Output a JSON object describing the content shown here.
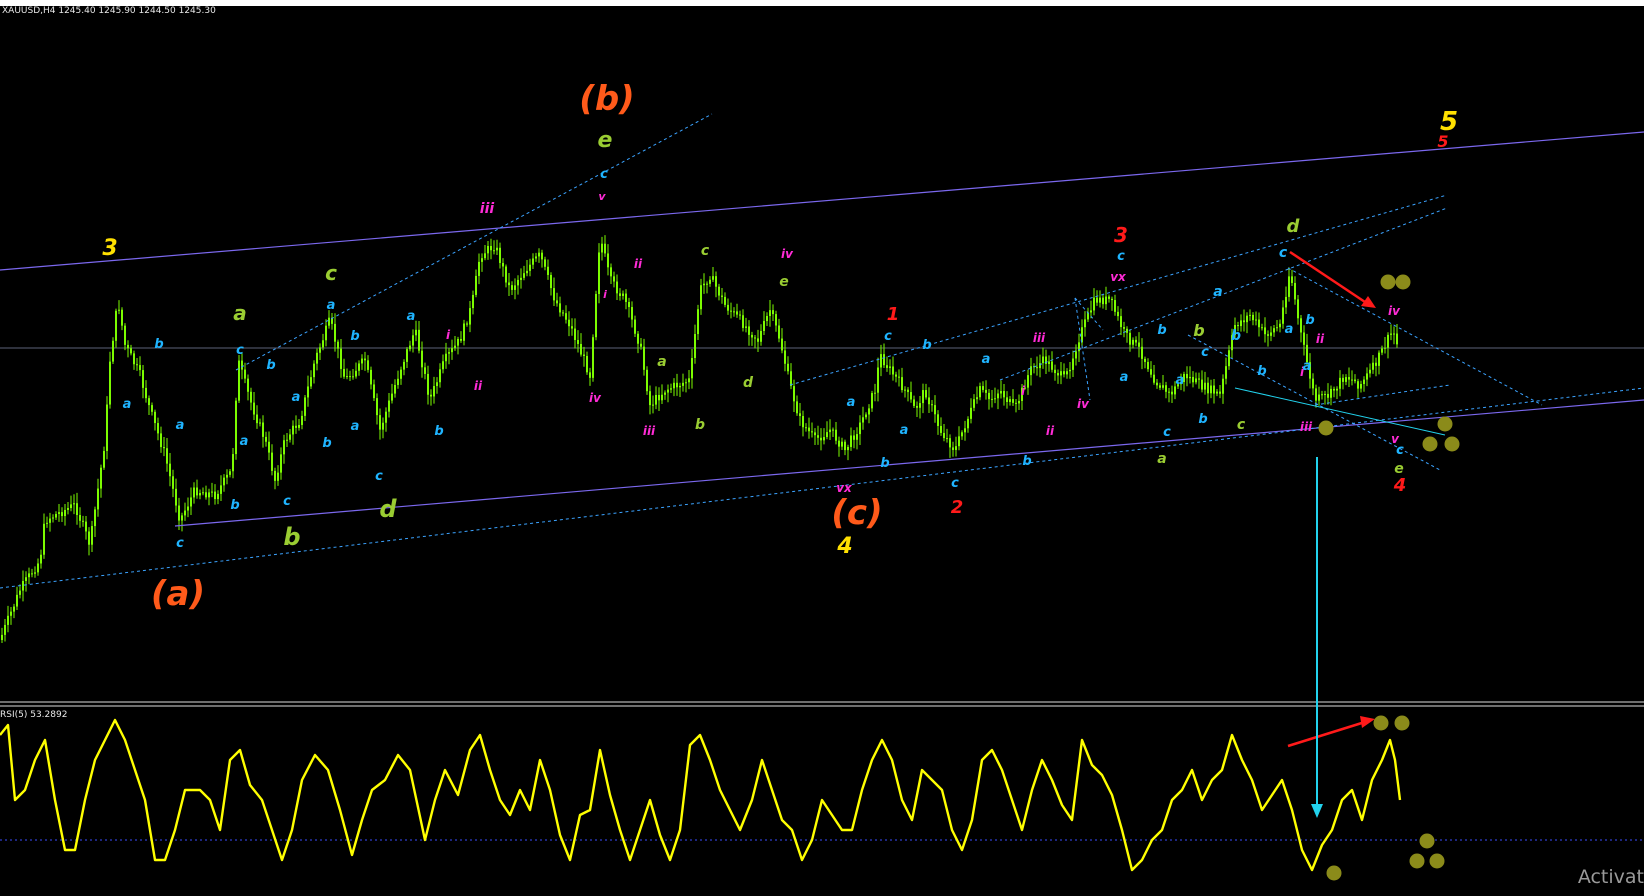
{
  "header": {
    "symbol_line": "XAUUSD,H4  1245.40 1245.90 1244.50 1245.30"
  },
  "indicator": {
    "label": "RSI(5) 53.2892"
  },
  "watermark": "Activat",
  "colors": {
    "background": "#000000",
    "candles": "#7CFC00",
    "channel": "#7B68EE",
    "dotted_trend": "#3BA3FF",
    "rsi": "#FFFF00",
    "arrow_red": "#FF1A1A",
    "arrow_cyan": "#22D3EE",
    "marker_dot": "#8B8B1A"
  },
  "chart_data": {
    "type": "candlestick",
    "symbol": "XAUUSD",
    "timeframe": "H4",
    "last_quote": {
      "open": 1245.4,
      "high": 1245.9,
      "low": 1244.5,
      "close": 1245.3
    },
    "indicator": {
      "name": "RSI",
      "period": 5,
      "value": 53.2892
    },
    "wave_labels": [
      {
        "text": "3",
        "color": "#FFE000"
      },
      {
        "text": "(b)",
        "color": "#FF5A1A"
      },
      {
        "text": "e",
        "color": "#9ACD32"
      },
      {
        "text": "(a)",
        "color": "#FF5A1A"
      },
      {
        "text": "(c)",
        "color": "#FF5A1A"
      },
      {
        "text": "4",
        "color": "#FFE000"
      },
      {
        "text": "5",
        "color": "#FFE000"
      },
      {
        "text": "5",
        "color": "#FF1A1A"
      },
      {
        "text": "3",
        "color": "#FF1A1A"
      },
      {
        "text": "1",
        "color": "#FF1A1A"
      },
      {
        "text": "2",
        "color": "#FF1A1A"
      },
      {
        "text": "4",
        "color": "#FF1A1A"
      },
      {
        "text": "a",
        "color": "#9ACD32"
      },
      {
        "text": "b",
        "color": "#9ACD32"
      },
      {
        "text": "c",
        "color": "#9ACD32"
      },
      {
        "text": "d",
        "color": "#9ACD32"
      },
      {
        "text": "c",
        "color": "#9ACD32"
      },
      {
        "text": "e",
        "color": "#9ACD32"
      },
      {
        "text": "a",
        "color": "#9ACD32"
      },
      {
        "text": "b",
        "color": "#9ACD32"
      },
      {
        "text": "d",
        "color": "#9ACD32"
      },
      {
        "text": "b",
        "color": "#9ACD32"
      },
      {
        "text": "c",
        "color": "#9ACD32"
      },
      {
        "text": "a",
        "color": "#9ACD32"
      },
      {
        "text": "d",
        "color": "#9ACD32"
      },
      {
        "text": "e",
        "color": "#9ACD32"
      },
      {
        "text": "iii",
        "color": "#FF2BD6"
      },
      {
        "text": "v",
        "color": "#FF2BD6"
      },
      {
        "text": "ii",
        "color": "#FF2BD6"
      },
      {
        "text": "iv",
        "color": "#FF2BD6"
      },
      {
        "text": "i",
        "color": "#FF2BD6"
      },
      {
        "text": "iv",
        "color": "#FF2BD6"
      },
      {
        "text": "iii",
        "color": "#FF2BD6"
      },
      {
        "text": "i",
        "color": "#FF2BD6"
      },
      {
        "text": "ii",
        "color": "#FF2BD6"
      },
      {
        "text": "vx",
        "color": "#FF2BD6"
      },
      {
        "text": "iii",
        "color": "#FF2BD6"
      },
      {
        "text": "i",
        "color": "#FF2BD6"
      },
      {
        "text": "ii",
        "color": "#FF2BD6"
      },
      {
        "text": "iv",
        "color": "#FF2BD6"
      },
      {
        "text": "vx",
        "color": "#FF2BD6"
      },
      {
        "text": "ii",
        "color": "#FF2BD6"
      },
      {
        "text": "i",
        "color": "#FF2BD6"
      },
      {
        "text": "iii",
        "color": "#FF2BD6"
      },
      {
        "text": "iv",
        "color": "#FF2BD6"
      },
      {
        "text": "v",
        "color": "#FF2BD6"
      },
      {
        "text": "a",
        "color": "#1FB4FF"
      },
      {
        "text": "b",
        "color": "#1FB4FF"
      },
      {
        "text": "c",
        "color": "#1FB4FF"
      }
    ]
  }
}
